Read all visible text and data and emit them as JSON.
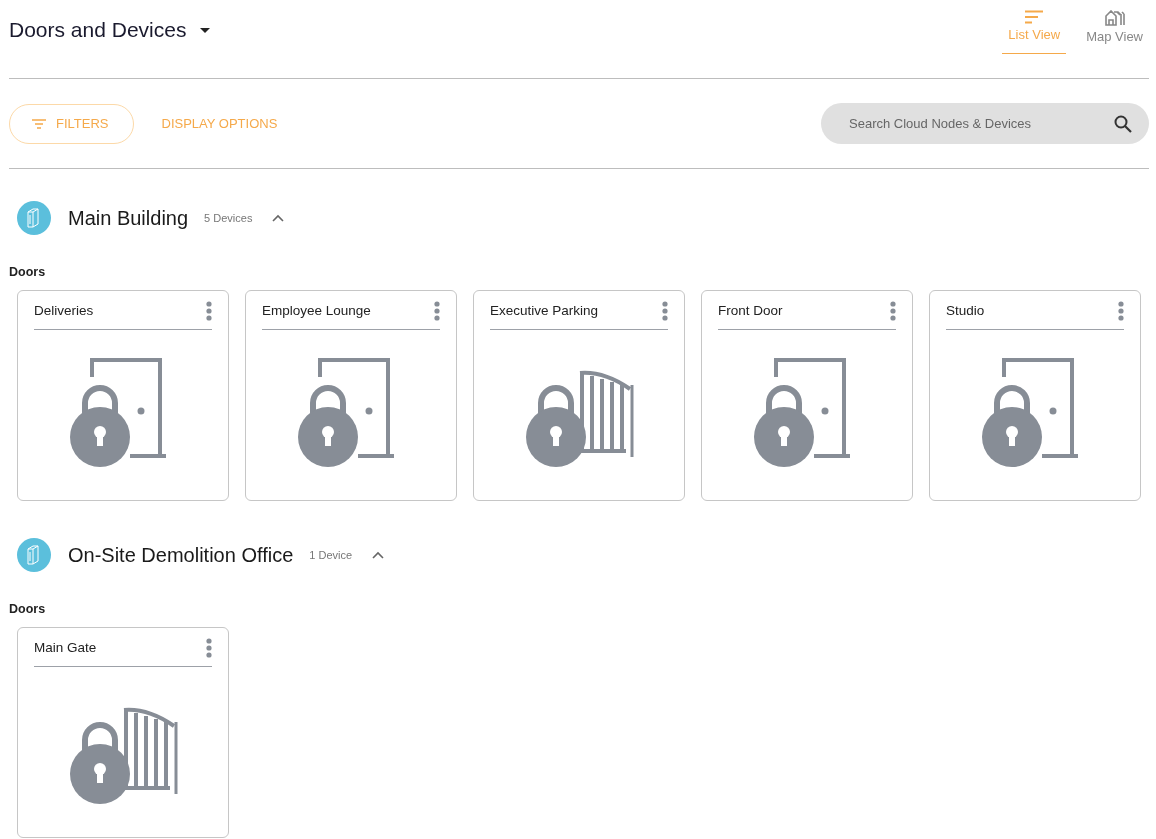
{
  "header": {
    "title": "Doors and Devices",
    "views": [
      {
        "label": "List View",
        "kind": "list",
        "selected": true
      },
      {
        "label": "Map View",
        "kind": "map",
        "selected": false
      }
    ]
  },
  "toolbar": {
    "filters": "FILTERS",
    "display_options": "DISPLAY OPTIONS",
    "search": {
      "placeholder": "Search Cloud Nodes & Devices"
    }
  },
  "sites": [
    {
      "name": "Main Building",
      "count": "5 Devices",
      "expanded": true,
      "groups": [
        {
          "label": "Doors",
          "devices": [
            {
              "name": "Deliveries",
              "kind": "door"
            },
            {
              "name": "Employee Lounge",
              "kind": "door"
            },
            {
              "name": "Executive Parking",
              "kind": "gate"
            },
            {
              "name": "Front Door",
              "kind": "door"
            },
            {
              "name": "Studio",
              "kind": "door"
            }
          ]
        }
      ]
    },
    {
      "name": "On-Site Demolition Office",
      "count": "1 Device",
      "expanded": true,
      "groups": [
        {
          "label": "Doors",
          "devices": [
            {
              "name": "Main Gate",
              "kind": "gate"
            }
          ]
        }
      ]
    }
  ]
}
